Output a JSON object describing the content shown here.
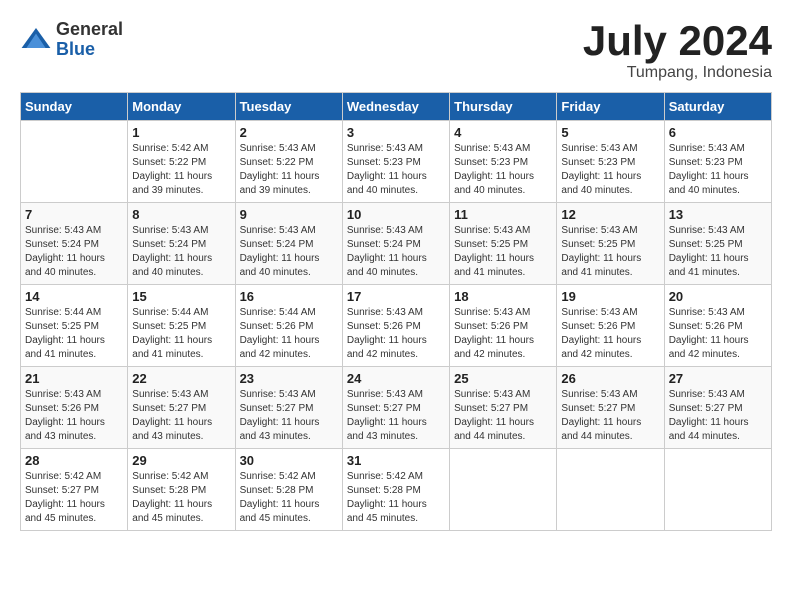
{
  "header": {
    "logo_general": "General",
    "logo_blue": "Blue",
    "month_year": "July 2024",
    "location": "Tumpang, Indonesia"
  },
  "columns": [
    "Sunday",
    "Monday",
    "Tuesday",
    "Wednesday",
    "Thursday",
    "Friday",
    "Saturday"
  ],
  "weeks": [
    [
      {
        "day": "",
        "sunrise": "",
        "sunset": "",
        "daylight": ""
      },
      {
        "day": "1",
        "sunrise": "Sunrise: 5:42 AM",
        "sunset": "Sunset: 5:22 PM",
        "daylight": "Daylight: 11 hours and 39 minutes."
      },
      {
        "day": "2",
        "sunrise": "Sunrise: 5:43 AM",
        "sunset": "Sunset: 5:22 PM",
        "daylight": "Daylight: 11 hours and 39 minutes."
      },
      {
        "day": "3",
        "sunrise": "Sunrise: 5:43 AM",
        "sunset": "Sunset: 5:23 PM",
        "daylight": "Daylight: 11 hours and 40 minutes."
      },
      {
        "day": "4",
        "sunrise": "Sunrise: 5:43 AM",
        "sunset": "Sunset: 5:23 PM",
        "daylight": "Daylight: 11 hours and 40 minutes."
      },
      {
        "day": "5",
        "sunrise": "Sunrise: 5:43 AM",
        "sunset": "Sunset: 5:23 PM",
        "daylight": "Daylight: 11 hours and 40 minutes."
      },
      {
        "day": "6",
        "sunrise": "Sunrise: 5:43 AM",
        "sunset": "Sunset: 5:23 PM",
        "daylight": "Daylight: 11 hours and 40 minutes."
      }
    ],
    [
      {
        "day": "7",
        "sunrise": "Sunrise: 5:43 AM",
        "sunset": "Sunset: 5:24 PM",
        "daylight": "Daylight: 11 hours and 40 minutes."
      },
      {
        "day": "8",
        "sunrise": "Sunrise: 5:43 AM",
        "sunset": "Sunset: 5:24 PM",
        "daylight": "Daylight: 11 hours and 40 minutes."
      },
      {
        "day": "9",
        "sunrise": "Sunrise: 5:43 AM",
        "sunset": "Sunset: 5:24 PM",
        "daylight": "Daylight: 11 hours and 40 minutes."
      },
      {
        "day": "10",
        "sunrise": "Sunrise: 5:43 AM",
        "sunset": "Sunset: 5:24 PM",
        "daylight": "Daylight: 11 hours and 40 minutes."
      },
      {
        "day": "11",
        "sunrise": "Sunrise: 5:43 AM",
        "sunset": "Sunset: 5:25 PM",
        "daylight": "Daylight: 11 hours and 41 minutes."
      },
      {
        "day": "12",
        "sunrise": "Sunrise: 5:43 AM",
        "sunset": "Sunset: 5:25 PM",
        "daylight": "Daylight: 11 hours and 41 minutes."
      },
      {
        "day": "13",
        "sunrise": "Sunrise: 5:43 AM",
        "sunset": "Sunset: 5:25 PM",
        "daylight": "Daylight: 11 hours and 41 minutes."
      }
    ],
    [
      {
        "day": "14",
        "sunrise": "Sunrise: 5:44 AM",
        "sunset": "Sunset: 5:25 PM",
        "daylight": "Daylight: 11 hours and 41 minutes."
      },
      {
        "day": "15",
        "sunrise": "Sunrise: 5:44 AM",
        "sunset": "Sunset: 5:25 PM",
        "daylight": "Daylight: 11 hours and 41 minutes."
      },
      {
        "day": "16",
        "sunrise": "Sunrise: 5:44 AM",
        "sunset": "Sunset: 5:26 PM",
        "daylight": "Daylight: 11 hours and 42 minutes."
      },
      {
        "day": "17",
        "sunrise": "Sunrise: 5:43 AM",
        "sunset": "Sunset: 5:26 PM",
        "daylight": "Daylight: 11 hours and 42 minutes."
      },
      {
        "day": "18",
        "sunrise": "Sunrise: 5:43 AM",
        "sunset": "Sunset: 5:26 PM",
        "daylight": "Daylight: 11 hours and 42 minutes."
      },
      {
        "day": "19",
        "sunrise": "Sunrise: 5:43 AM",
        "sunset": "Sunset: 5:26 PM",
        "daylight": "Daylight: 11 hours and 42 minutes."
      },
      {
        "day": "20",
        "sunrise": "Sunrise: 5:43 AM",
        "sunset": "Sunset: 5:26 PM",
        "daylight": "Daylight: 11 hours and 42 minutes."
      }
    ],
    [
      {
        "day": "21",
        "sunrise": "Sunrise: 5:43 AM",
        "sunset": "Sunset: 5:26 PM",
        "daylight": "Daylight: 11 hours and 43 minutes."
      },
      {
        "day": "22",
        "sunrise": "Sunrise: 5:43 AM",
        "sunset": "Sunset: 5:27 PM",
        "daylight": "Daylight: 11 hours and 43 minutes."
      },
      {
        "day": "23",
        "sunrise": "Sunrise: 5:43 AM",
        "sunset": "Sunset: 5:27 PM",
        "daylight": "Daylight: 11 hours and 43 minutes."
      },
      {
        "day": "24",
        "sunrise": "Sunrise: 5:43 AM",
        "sunset": "Sunset: 5:27 PM",
        "daylight": "Daylight: 11 hours and 43 minutes."
      },
      {
        "day": "25",
        "sunrise": "Sunrise: 5:43 AM",
        "sunset": "Sunset: 5:27 PM",
        "daylight": "Daylight: 11 hours and 44 minutes."
      },
      {
        "day": "26",
        "sunrise": "Sunrise: 5:43 AM",
        "sunset": "Sunset: 5:27 PM",
        "daylight": "Daylight: 11 hours and 44 minutes."
      },
      {
        "day": "27",
        "sunrise": "Sunrise: 5:43 AM",
        "sunset": "Sunset: 5:27 PM",
        "daylight": "Daylight: 11 hours and 44 minutes."
      }
    ],
    [
      {
        "day": "28",
        "sunrise": "Sunrise: 5:42 AM",
        "sunset": "Sunset: 5:27 PM",
        "daylight": "Daylight: 11 hours and 45 minutes."
      },
      {
        "day": "29",
        "sunrise": "Sunrise: 5:42 AM",
        "sunset": "Sunset: 5:28 PM",
        "daylight": "Daylight: 11 hours and 45 minutes."
      },
      {
        "day": "30",
        "sunrise": "Sunrise: 5:42 AM",
        "sunset": "Sunset: 5:28 PM",
        "daylight": "Daylight: 11 hours and 45 minutes."
      },
      {
        "day": "31",
        "sunrise": "Sunrise: 5:42 AM",
        "sunset": "Sunset: 5:28 PM",
        "daylight": "Daylight: 11 hours and 45 minutes."
      },
      {
        "day": "",
        "sunrise": "",
        "sunset": "",
        "daylight": ""
      },
      {
        "day": "",
        "sunrise": "",
        "sunset": "",
        "daylight": ""
      },
      {
        "day": "",
        "sunrise": "",
        "sunset": "",
        "daylight": ""
      }
    ]
  ]
}
